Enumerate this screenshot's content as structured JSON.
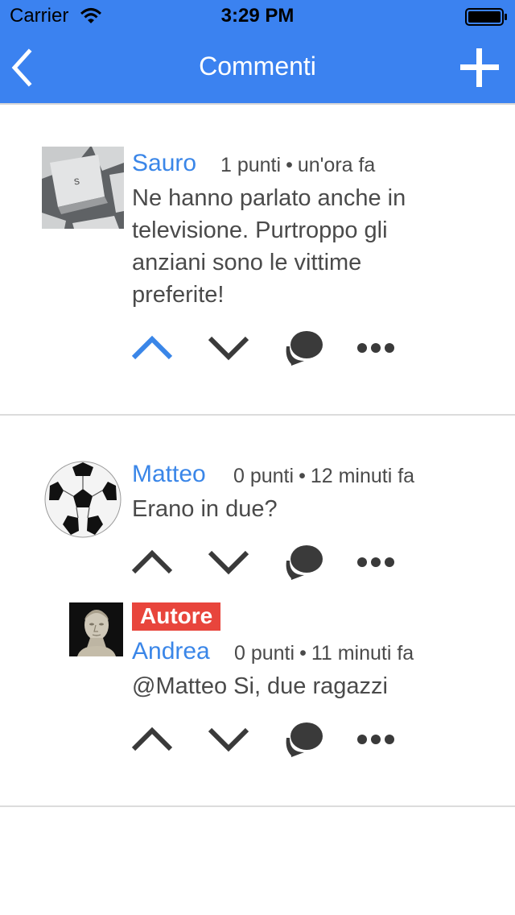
{
  "status_bar": {
    "carrier": "Carrier",
    "time": "3:29 PM"
  },
  "nav": {
    "title": "Commenti",
    "back_icon": "chevron-left-icon",
    "add_icon": "plus-icon"
  },
  "colors": {
    "bar": "#3b82f0",
    "author": "#3a86e8",
    "upvote_active": "#3a86e8",
    "icon": "#3a3a3a",
    "badge": "#e8453c"
  },
  "comments": [
    {
      "author": "Sauro",
      "points": "1 punti",
      "separator": "•",
      "time": "un'ora fa",
      "text": "Ne hanno parlato anche in televisione. Purtroppo gli anziani sono le vittime preferite!",
      "avatar": "keyboard-key-photo",
      "upvoted": true
    },
    {
      "author": "Matteo",
      "points": "0 punti",
      "separator": "•",
      "time": "12 minuti fa",
      "text": "Erano in due?",
      "avatar": "soccer-ball-photo",
      "upvoted": false
    }
  ],
  "replies": [
    {
      "badge": "Autore",
      "author": "Andrea",
      "points": "0 punti",
      "separator": "•",
      "time": "11 minuti fa",
      "text": "@Matteo Si, due ragazzi",
      "avatar": "roman-bust-photo",
      "upvoted": false
    }
  ]
}
